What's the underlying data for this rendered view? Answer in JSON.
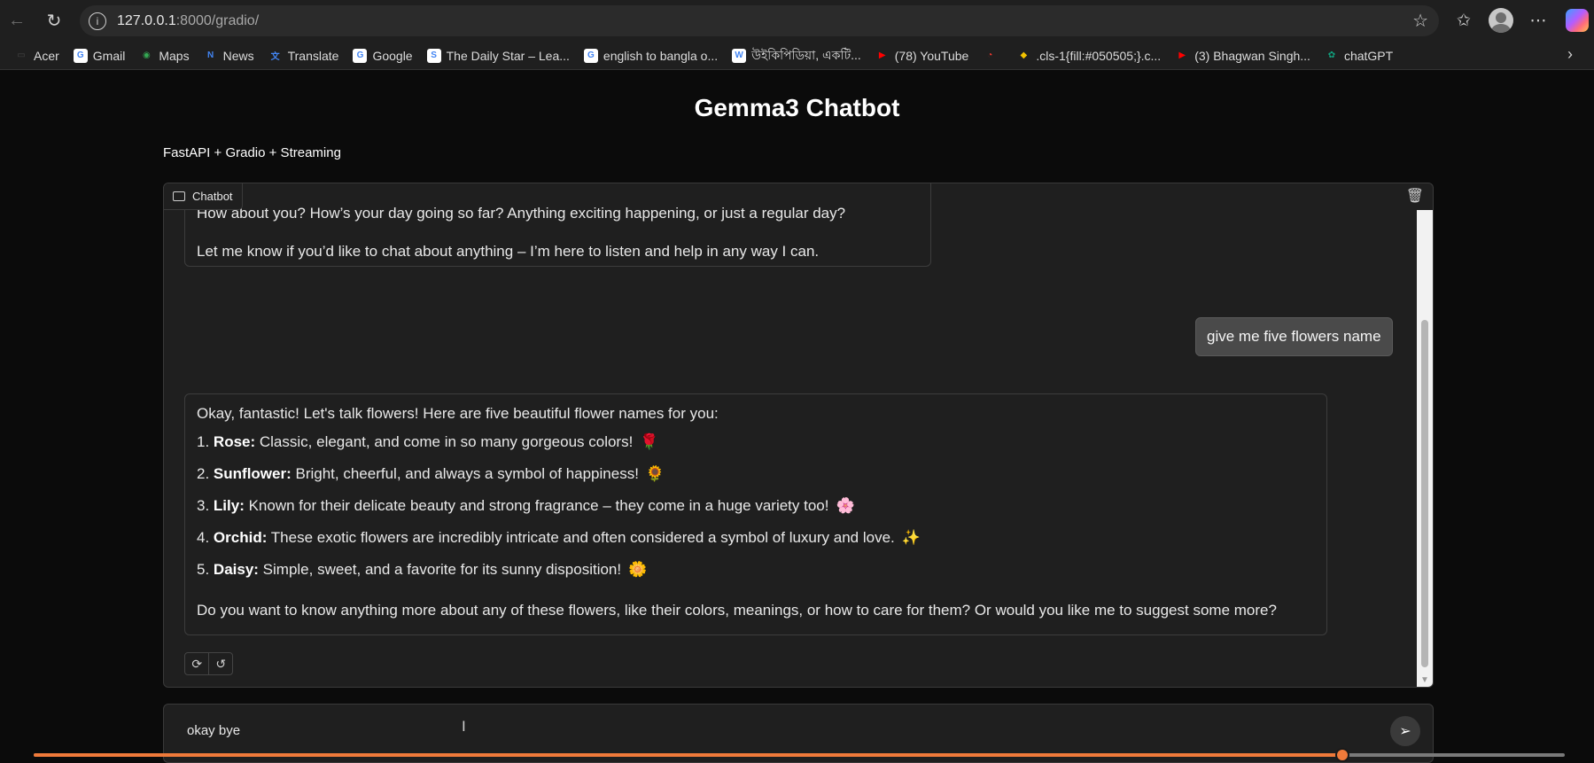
{
  "browser": {
    "url_host": "127.0.0.1",
    "url_rest": ":8000/gradio/",
    "bookmarks": [
      {
        "label": "Acer",
        "icon": "folder-icon",
        "color": "#444444"
      },
      {
        "label": "Gmail",
        "icon": "google-icon",
        "color": "#ffffff"
      },
      {
        "label": "Maps",
        "icon": "maps-icon",
        "color": "#34a853"
      },
      {
        "label": "News",
        "icon": "news-icon",
        "color": "#4285f4"
      },
      {
        "label": "Translate",
        "icon": "translate-icon",
        "color": "#4285f4"
      },
      {
        "label": "Google",
        "icon": "google-icon",
        "color": "#ffffff"
      },
      {
        "label": "The Daily Star – Lea...",
        "icon": "daily-star-icon",
        "color": "#ffffff"
      },
      {
        "label": "english to bangla o...",
        "icon": "google-icon",
        "color": "#ffffff"
      },
      {
        "label": "উইকিপিডিয়া, একটি...",
        "icon": "wikipedia-icon",
        "color": "#ffffff"
      },
      {
        "label": "(78) YouTube",
        "icon": "youtube-icon",
        "color": "#ff0000"
      },
      {
        "label": "",
        "icon": "red-swirl-icon",
        "color": "#ff3b30"
      },
      {
        "label": ".cls-1{fill:#050505;}.c...",
        "icon": "hat-icon",
        "color": "#f2c200"
      },
      {
        "label": "(3) Bhagwan Singh...",
        "icon": "youtube-icon",
        "color": "#ff0000"
      },
      {
        "label": "chatGPT",
        "icon": "chatgpt-icon",
        "color": "#10a37f"
      }
    ]
  },
  "app": {
    "title": "Gemma3 Chatbot",
    "subtitle": "FastAPI + Gradio + Streaming",
    "chat_label": "Chatbot",
    "input_value": "okay bye"
  },
  "messages": {
    "first_bot": {
      "line1": "How about you? How’s your day going so far? Anything exciting happening, or just a regular day?",
      "line2": "Let me know if you’d like to chat about anything – I’m here to listen and help in any way I can."
    },
    "user": "give me five flowers name",
    "second_bot": {
      "intro": "Okay, fantastic! Let's talk flowers! Here are five beautiful flower names for you:",
      "items": [
        {
          "num": "1.",
          "name": "Rose:",
          "text": " Classic, elegant, and come in so many gorgeous colors!",
          "emoji": "🌹"
        },
        {
          "num": "2.",
          "name": "Sunflower:",
          "text": " Bright, cheerful, and always a symbol of happiness!",
          "emoji": "🌻"
        },
        {
          "num": "3.",
          "name": "Lily:",
          "text": " Known for their delicate beauty and strong fragrance – they come in a huge variety too!",
          "emoji": "🌸"
        },
        {
          "num": "4.",
          "name": "Orchid:",
          "text": " These exotic flowers are incredibly intricate and often considered a symbol of luxury and love.",
          "emoji": "✨"
        },
        {
          "num": "5.",
          "name": "Daisy:",
          "text": " Simple, sweet, and a favorite for its sunny disposition!",
          "emoji": "🌼"
        }
      ],
      "outro": "Do you want to know anything more about any of these flowers, like their colors, meanings, or how to care for them? Or would you like me to suggest some more?"
    }
  },
  "video_progress": 0.855
}
